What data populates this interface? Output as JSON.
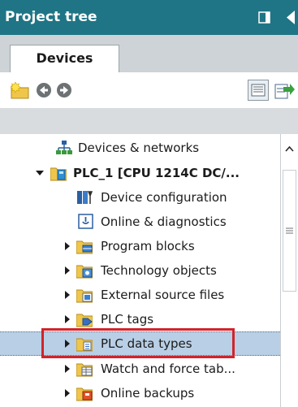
{
  "panel": {
    "title": "Project tree"
  },
  "tabs": [
    {
      "label": "Devices"
    }
  ],
  "toolbar": {
    "icons": [
      "new-folder-icon",
      "back-icon",
      "forward-icon",
      "details-view-icon",
      "export-icon"
    ]
  },
  "tree": [
    {
      "label": "Devices & networks",
      "icon": "network-icon",
      "expander": "none"
    },
    {
      "label": "PLC_1 [CPU 1214C DC/...",
      "icon": "plc-icon",
      "expander": "expanded",
      "bold": true
    },
    {
      "label": "Device configuration",
      "icon": "device-config-icon",
      "expander": "none"
    },
    {
      "label": "Online & diagnostics",
      "icon": "diagnostics-icon",
      "expander": "none"
    },
    {
      "label": "Program blocks",
      "icon": "program-blocks-folder-icon",
      "expander": "collapsed"
    },
    {
      "label": "Technology objects",
      "icon": "technology-folder-icon",
      "expander": "collapsed"
    },
    {
      "label": "External source files",
      "icon": "source-files-folder-icon",
      "expander": "collapsed"
    },
    {
      "label": "PLC tags",
      "icon": "tags-folder-icon",
      "expander": "collapsed"
    },
    {
      "label": "PLC data types",
      "icon": "data-types-folder-icon",
      "expander": "collapsed",
      "selected": true
    },
    {
      "label": "Watch and force tab...",
      "icon": "watch-folder-icon",
      "expander": "collapsed"
    },
    {
      "label": "Online backups",
      "icon": "backup-folder-icon",
      "expander": "collapsed"
    }
  ],
  "colors": {
    "title_bar": "#1f7585",
    "selection": "#b9cfe5",
    "highlight_box": "#d0232a"
  }
}
